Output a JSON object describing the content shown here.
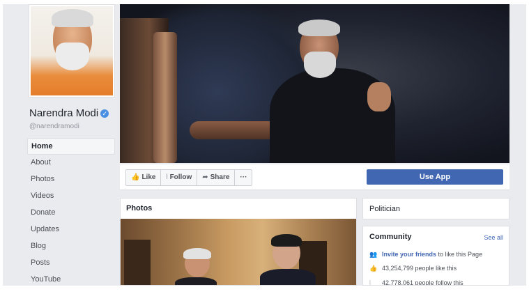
{
  "profile": {
    "name": "Narendra Modi",
    "handle": "@narendramodi",
    "verified_icon": "verified-badge-icon"
  },
  "nav": {
    "items": [
      {
        "label": "Home",
        "active": true
      },
      {
        "label": "About"
      },
      {
        "label": "Photos"
      },
      {
        "label": "Videos"
      },
      {
        "label": "Donate"
      },
      {
        "label": "Updates"
      },
      {
        "label": "Blog"
      },
      {
        "label": "Posts"
      },
      {
        "label": "YouTube"
      }
    ]
  },
  "actions": {
    "like": "Like",
    "follow": "Follow",
    "share": "Share",
    "more": "···",
    "use_app": "Use App"
  },
  "photos": {
    "title": "Photos"
  },
  "category": {
    "text": "Politician"
  },
  "community": {
    "title": "Community",
    "see_all": "See all",
    "invite_link": "Invite your friends",
    "invite_rest": " to like this Page",
    "likes": "43,254,799 people like this",
    "follows": "42,778,061 people follow this"
  },
  "colors": {
    "accent": "#4267b2",
    "background": "#e9ebee",
    "verified": "#4a90e2"
  }
}
